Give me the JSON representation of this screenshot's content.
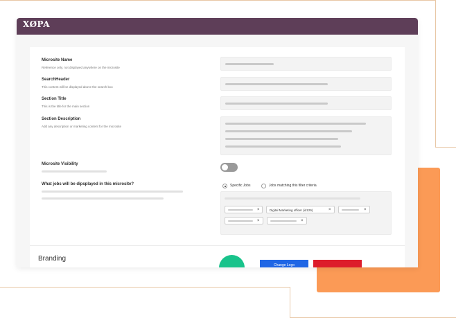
{
  "app": {
    "logo_text": "XØPA",
    "logo_tagline": ""
  },
  "form": {
    "microsite_name": {
      "label": "Microsite Name",
      "help": "Reference only, not displayed anywhere on the microsite"
    },
    "search_header": {
      "label": "SearchHeader",
      "help": "This content will be displayed above the search box"
    },
    "section_title": {
      "label": "Section Title",
      "help": "This is the title for the main section"
    },
    "section_description": {
      "label": "Section Description",
      "help": "Add any description or marketing content for the microsite"
    },
    "visibility": {
      "label": "Microsite Visibility",
      "enabled": false
    },
    "jobs": {
      "label": "What jobs will be dipsplayed in this microsite?",
      "options": [
        "Specific Jobs",
        "Jobs matching this filter criteria"
      ],
      "selected": "Specific Jobs",
      "chips": [
        "",
        "Digital Marketing officer (id129)",
        "",
        "",
        ""
      ]
    }
  },
  "branding": {
    "title": "Branding",
    "change_logo_label": "Change Logo"
  },
  "colors": {
    "topbar": "#5e3e58",
    "accent_orange": "#fb9a56",
    "avatar": "#19c38b",
    "blue_button": "#1f66e5",
    "red_button": "#dd1c2b"
  }
}
